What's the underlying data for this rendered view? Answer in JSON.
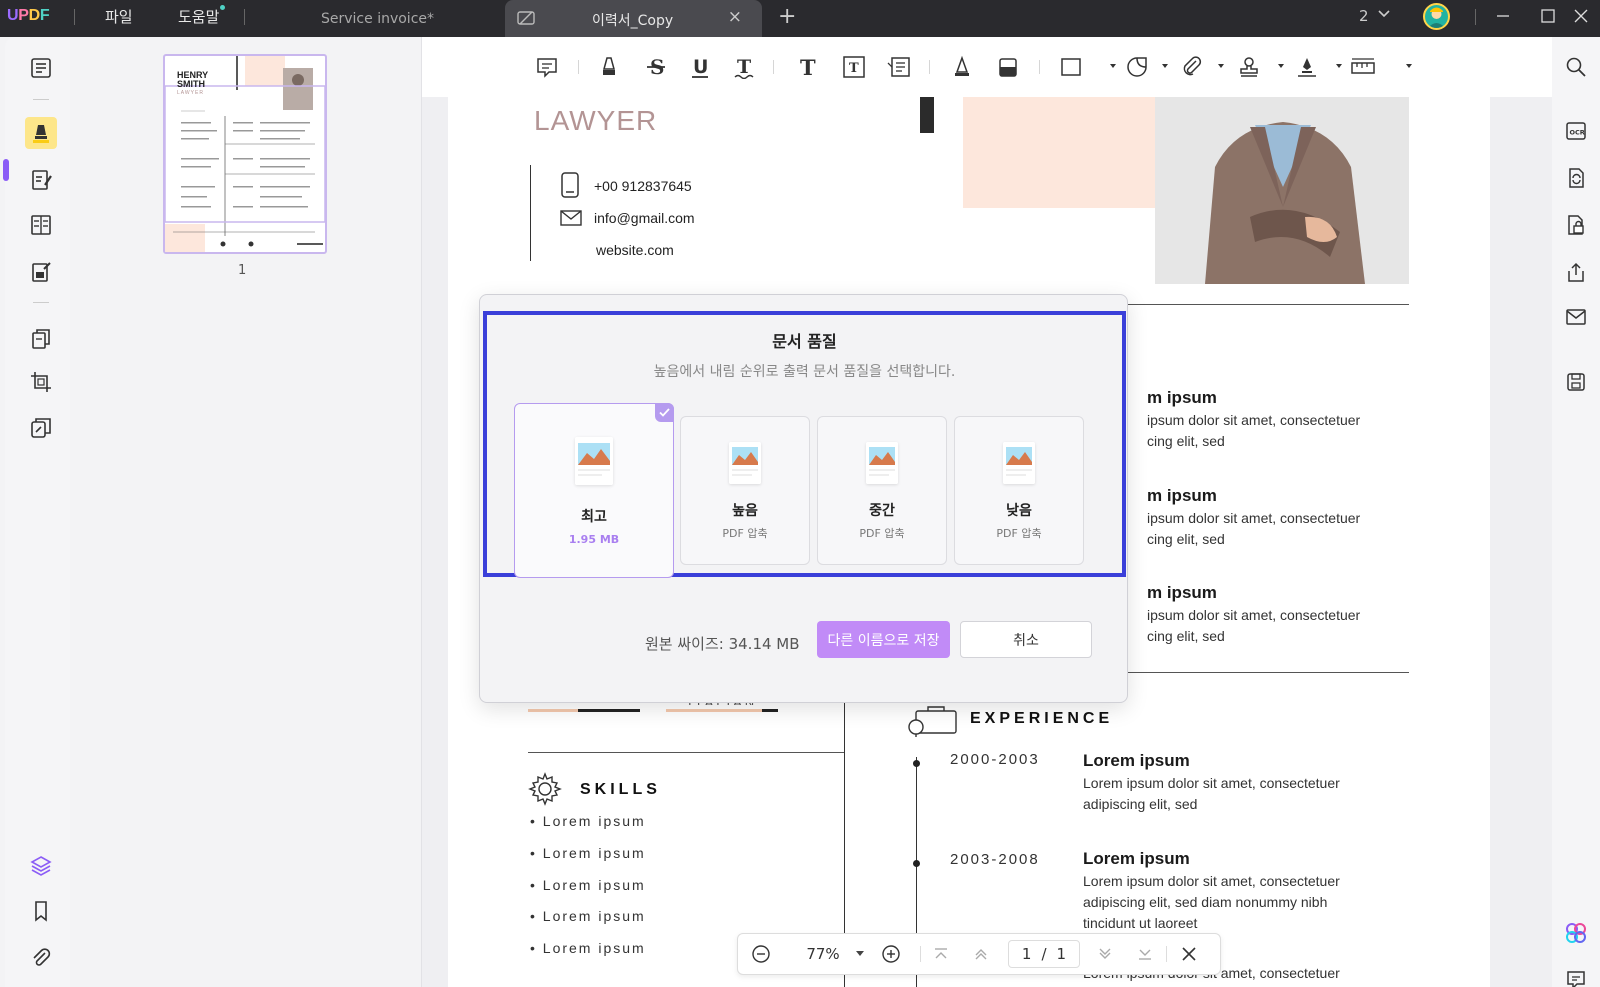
{
  "app": {
    "logo": {
      "u": "U",
      "p": "P",
      "d": "D",
      "f": "F"
    },
    "menus": [
      "파일",
      "도움말"
    ],
    "tabs": [
      {
        "label": "Service invoice*",
        "active": false
      },
      {
        "label": "이력서_Copy",
        "active": true
      }
    ],
    "page_count": "2",
    "colors": {
      "accent": "#8b5cf6",
      "save_button": "#c18bf7",
      "dialog_frame": "#3a3fd9"
    }
  },
  "thumbnails": {
    "page_number": "1",
    "preview": {
      "name_line1": "HENRY",
      "name_line2": "SMITH",
      "role": "LAWYER"
    }
  },
  "document": {
    "title": "LAWYER",
    "contact": {
      "phone": "+00 912837645",
      "email": "info@gmail.com",
      "website": "website.com"
    },
    "items": [
      {
        "title": "m ipsum",
        "body1": "ipsum dolor sit amet, consectetuer",
        "body2": "cing elit, sed"
      },
      {
        "title": "m ipsum",
        "body1": "ipsum dolor sit amet, consectetuer",
        "body2": "cing elit, sed"
      },
      {
        "title": "m ipsum",
        "body1": "ipsum dolor sit amet, consectetuer",
        "body2": "cing elit, sed"
      }
    ],
    "language_fragment": "ITALIAN",
    "experience": {
      "title": "EXPERIENCE",
      "entries": [
        {
          "years": "2000-2003",
          "title": "Lorem ipsum",
          "body1": "Lorem ipsum dolor sit amet, consectetuer",
          "body2": "adipiscing elit, sed",
          "body3": ""
        },
        {
          "years": "2003-2008",
          "title": "Lorem ipsum",
          "body1": "Lorem ipsum dolor sit amet, consectetuer",
          "body2": "adipiscing elit, sed diam nonummy nibh",
          "body3": "tincidunt ut laoreet"
        }
      ],
      "cut_line": "Lorem ipsum dolor sit amet, consectetuer"
    },
    "skills": {
      "title": "SKILLS",
      "items": [
        "• Lorem ipsum",
        "• Lorem ipsum",
        "• Lorem ipsum",
        "• Lorem ipsum",
        "• Lorem ipsum"
      ]
    }
  },
  "dialog": {
    "title": "문서 품질",
    "subtitle": "높음에서 내림 순위로 출력 문서 품질을 선택합니다.",
    "options": [
      {
        "name": "최고",
        "meta": "1.95 MB",
        "selected": true
      },
      {
        "name": "높음",
        "meta": "PDF 압축",
        "selected": false
      },
      {
        "name": "중간",
        "meta": "PDF 압축",
        "selected": false
      },
      {
        "name": "낮음",
        "meta": "PDF 압축",
        "selected": false
      }
    ],
    "original_size": "원본 싸이즈: 34.14 MB",
    "save_label": "다른 이름으로 저장",
    "cancel_label": "취소"
  },
  "zoom": {
    "level": "77%",
    "current_page": "1",
    "separator": "/",
    "total_pages": "1"
  }
}
